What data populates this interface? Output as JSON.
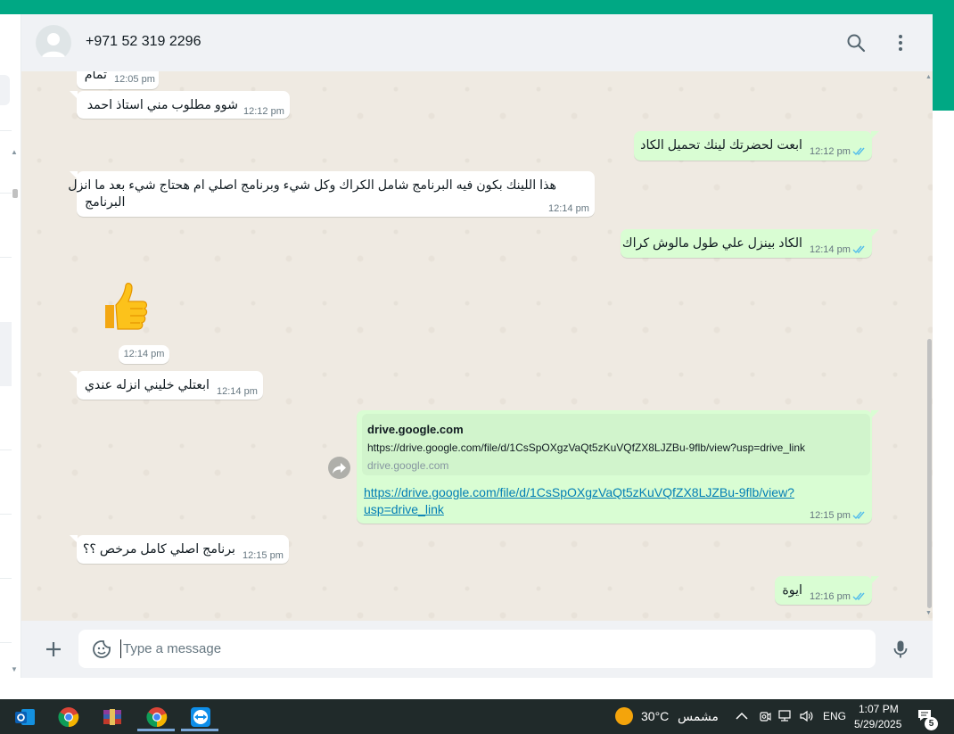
{
  "colors": {
    "accent": "#00a884",
    "chat_bg": "#efeae2",
    "incoming": "#ffffff",
    "outgoing": "#d9fdd3",
    "read_ticks": "#53bdeb",
    "link": "#027eb5"
  },
  "header": {
    "contact_name": "+971 52 319 2296",
    "avatar_icon": "default-avatar-icon",
    "search_icon": "search-icon",
    "menu_icon": "kebab-menu-icon"
  },
  "messages": [
    {
      "direction": "in",
      "text": "تمام",
      "time": "12:05 pm"
    },
    {
      "direction": "in",
      "text": "شوو مطلوب مني استاذ احمد",
      "time": "12:12 pm"
    },
    {
      "direction": "out",
      "text": "ابعت لحضرتك لينك تحميل الكاد",
      "time": "12:12 pm",
      "status": "read"
    },
    {
      "direction": "in",
      "text_line1": "هذا اللينك بكون فيه البرنامج شامل الكراك وكل شيء وبرنامج اصلي ام هحتاج شيء بعد ما انزل",
      "text_line2": "البرنامج",
      "time": "12:14 pm"
    },
    {
      "direction": "out",
      "text": "الكاد بينزل علي طول مالوش كراك",
      "time": "12:14 pm",
      "status": "read"
    },
    {
      "direction": "in",
      "emoji": "👍",
      "time": "12:14 pm"
    },
    {
      "direction": "in",
      "text": "ابعتلي خليني انزله عندي",
      "time": "12:14 pm"
    },
    {
      "direction": "out",
      "link_preview": {
        "title": "drive.google.com",
        "description": "https://drive.google.com/file/d/1CsSpOXgzVaQt5zKuVQfZX8LJZBu-9flb/view?usp=drive_link",
        "domain": "drive.google.com"
      },
      "url_line1": "https://drive.google.com/file/d/1CsSpOXgzVaQt5zKuVQfZX8LJZBu-9flb/view?",
      "url_line2": "usp=drive_link",
      "time": "12:15 pm",
      "status": "read"
    },
    {
      "direction": "in",
      "text": "برنامج اصلي كامل مرخص ؟؟",
      "time": "12:15 pm"
    },
    {
      "direction": "out",
      "text": "ايوة",
      "time": "12:16 pm",
      "status": "read"
    }
  ],
  "composer": {
    "placeholder": "Type a message",
    "attach_icon": "plus-icon",
    "sticker_icon": "sticker-icon",
    "mic_icon": "microphone-icon"
  },
  "taskbar": {
    "apps": [
      "outlook-icon",
      "chrome-icon",
      "winrar-icon",
      "chrome-icon",
      "teamviewer-icon"
    ],
    "weather": {
      "temp": "30°C",
      "condition": "مشمس",
      "icon": "sun-icon"
    },
    "tray": {
      "chevron_icon": "chevron-up-icon",
      "lang": "ENG"
    },
    "clock": {
      "time": "1:07 PM",
      "date": "5/29/2025"
    },
    "notifications": {
      "count": "5",
      "icon": "notification-icon"
    }
  }
}
